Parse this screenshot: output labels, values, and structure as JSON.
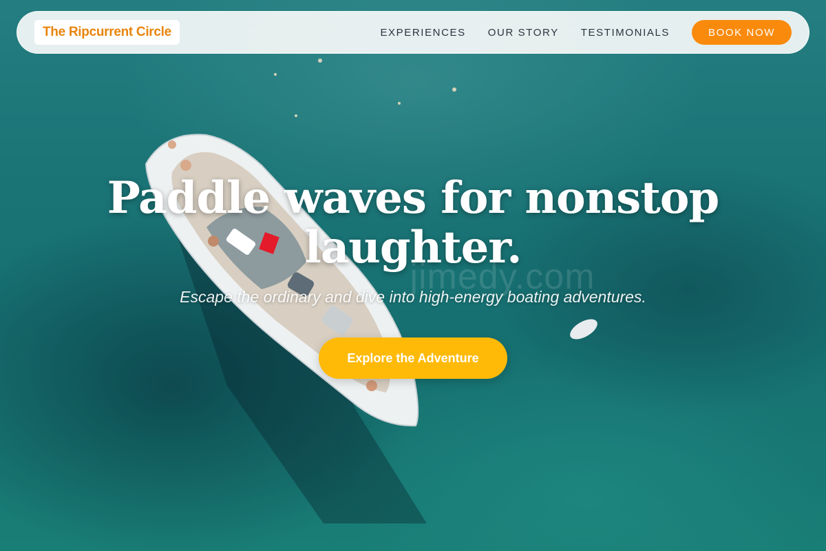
{
  "header": {
    "logo": "The Ripcurrent Circle",
    "nav": [
      {
        "label": "EXPERIENCES"
      },
      {
        "label": "OUR STORY"
      },
      {
        "label": "TESTIMONIALS"
      }
    ],
    "book_label": "BOOK NOW"
  },
  "hero": {
    "title_line1": "Paddle waves for nonstop",
    "title_line2": "laughter.",
    "subtitle": "Escape the ordinary and dive into high-energy boating adventures.",
    "cta_label": "Explore the Adventure",
    "watermark": "jimedy.com",
    "background_image": "aerial view of white speedboat on turquoise sea"
  },
  "colors": {
    "logo": "#e8840c",
    "book_button": "#f98a0c",
    "cta_button": "#ffba08",
    "nav_text": "#2b3440"
  }
}
